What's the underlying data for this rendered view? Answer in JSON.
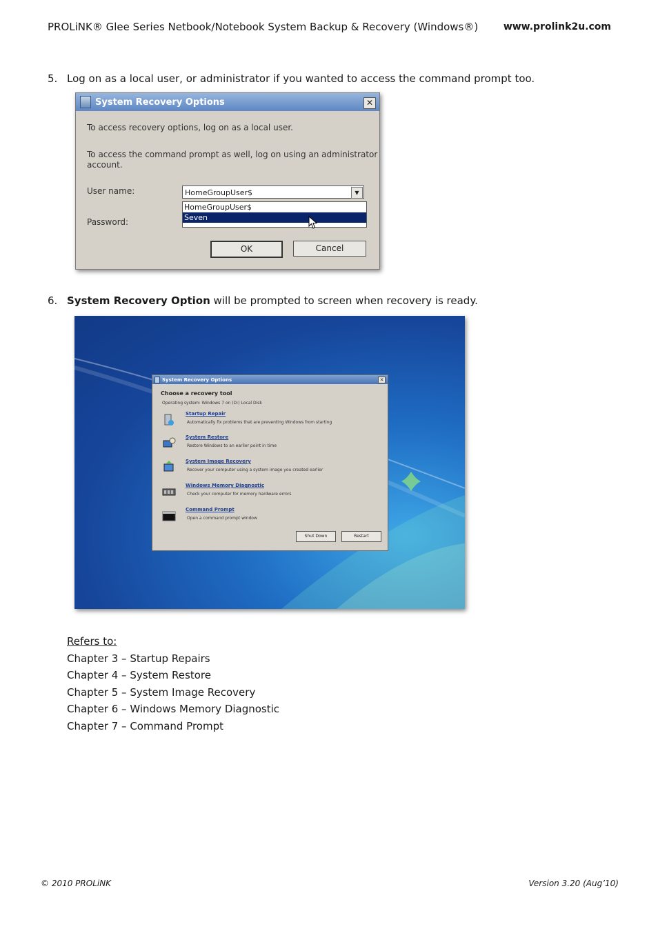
{
  "header": {
    "title": "PROLiNK® Glee Series Netbook/Notebook System Backup & Recovery (Windows®)",
    "website": "www.prolink2u.com"
  },
  "step5": {
    "number": "5.",
    "text": "Log on as a local user, or administrator if you wanted to access the command prompt too."
  },
  "login_dialog": {
    "title": "System Recovery Options",
    "line1": "To access recovery options, log on as a local user.",
    "line2a": "To access the command prompt as well, log on using an administrator",
    "line2b": "account.",
    "user_label": "User name:",
    "password_label": "Password:",
    "user_value": "HomeGroupUser$",
    "options": [
      "HomeGroupUser$",
      "Seven"
    ],
    "ok": "OK",
    "cancel": "Cancel"
  },
  "step6": {
    "number": "6.",
    "bold": "System Recovery Option",
    "text": " will be prompted to screen when recovery is ready."
  },
  "recovery_dialog": {
    "title": "System Recovery Options",
    "heading": "Choose a recovery tool",
    "os": "Operating system: Windows 7 on (D:) Local Disk",
    "tools": [
      {
        "name": "Startup Repair",
        "desc": "Automatically fix problems that are preventing Windows from starting"
      },
      {
        "name": "System Restore",
        "desc": "Restore Windows to an earlier point in time"
      },
      {
        "name": "System Image Recovery",
        "desc": "Recover your computer using a system image you created earlier"
      },
      {
        "name": "Windows Memory Diagnostic",
        "desc": "Check your computer for memory hardware errors"
      },
      {
        "name": "Command Prompt",
        "desc": "Open a command prompt window"
      }
    ],
    "shutdown": "Shut Down",
    "restart": "Restart"
  },
  "refs": {
    "heading": "Refers to:",
    "items": [
      "Chapter 3 – Startup Repairs",
      "Chapter 4 – System Restore",
      "Chapter 5 – System Image Recovery",
      "Chapter 6 – Windows Memory Diagnostic",
      "Chapter 7 – Command Prompt"
    ]
  },
  "footer": {
    "copyright": "© 2010 PROLiNK",
    "version": "Version 3.20 (Aug’10)"
  }
}
